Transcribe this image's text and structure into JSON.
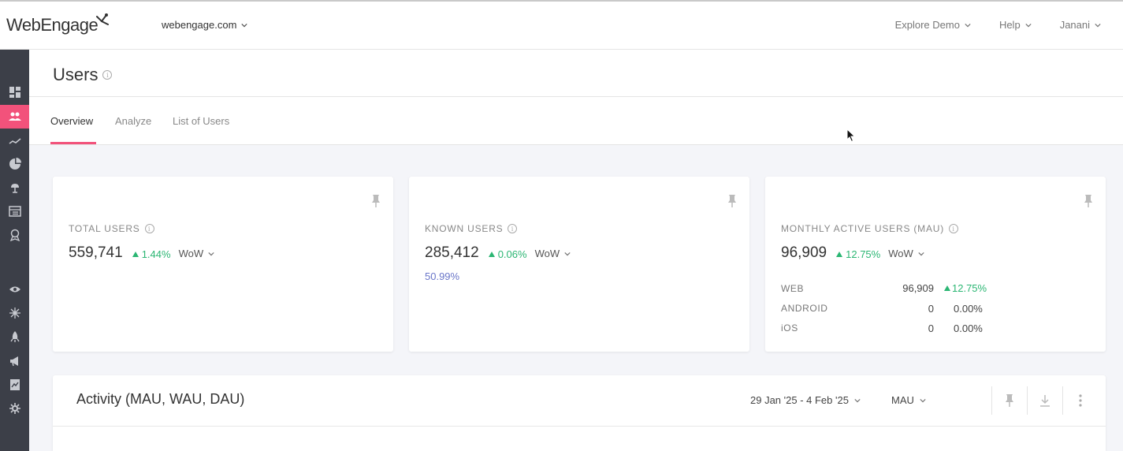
{
  "header": {
    "logo_text": "WebEngage",
    "account_name": "webengage.com",
    "nav": [
      {
        "label": "Explore Demo"
      },
      {
        "label": "Help"
      },
      {
        "label": "Janani"
      }
    ]
  },
  "sidebar": {
    "items": [
      {
        "icon": "dashboard-icon"
      },
      {
        "icon": "users-icon",
        "active": true
      },
      {
        "icon": "trend-icon"
      },
      {
        "icon": "pie-chart-icon"
      },
      {
        "icon": "journey-icon"
      },
      {
        "icon": "catalog-icon"
      },
      {
        "icon": "badge-icon"
      },
      {
        "icon": "eye-icon"
      },
      {
        "icon": "integration-icon"
      },
      {
        "icon": "rocket-icon"
      },
      {
        "icon": "megaphone-icon"
      },
      {
        "icon": "report-icon"
      },
      {
        "icon": "settings-icon"
      }
    ]
  },
  "page": {
    "title": "Users"
  },
  "tabs": [
    {
      "label": "Overview",
      "active": true
    },
    {
      "label": "Analyze"
    },
    {
      "label": "List of Users"
    }
  ],
  "cards": {
    "total": {
      "label": "TOTAL USERS",
      "value": "559,741",
      "delta": "1.44%",
      "period": "WoW"
    },
    "known": {
      "label": "KNOWN USERS",
      "value": "285,412",
      "delta": "0.06%",
      "period": "WoW",
      "percent_of_total": "50.99%"
    },
    "mau": {
      "label": "MONTHLY ACTIVE USERS (MAU)",
      "value": "96,909",
      "delta": "12.75%",
      "period": "WoW",
      "platforms": [
        {
          "name": "WEB",
          "value": "96,909",
          "delta": "12.75%",
          "trend": "up"
        },
        {
          "name": "ANDROID",
          "value": "0",
          "delta": "0.00%",
          "trend": "flat"
        },
        {
          "name": "iOS",
          "value": "0",
          "delta": "0.00%",
          "trend": "flat"
        }
      ]
    }
  },
  "activity": {
    "title": "Activity (MAU, WAU, DAU)",
    "date_range": "29 Jan '25 - 4 Feb '25",
    "metric": "MAU"
  },
  "colors": {
    "accent": "#f2527b",
    "positive": "#2bb673",
    "link": "#6a76c9",
    "sidebar": "#3c3f48"
  }
}
